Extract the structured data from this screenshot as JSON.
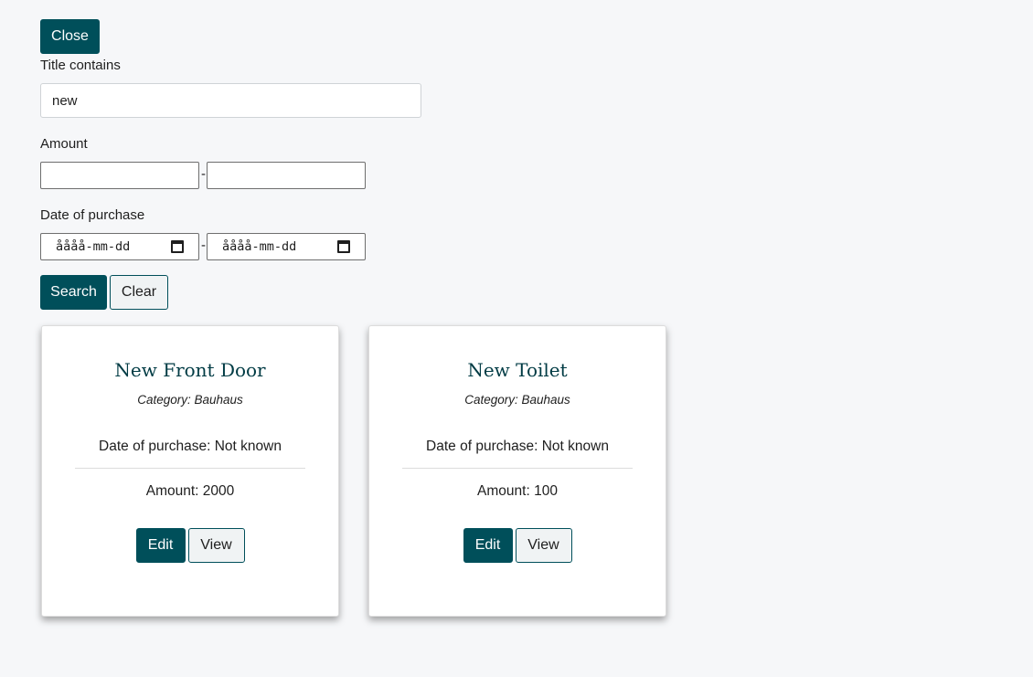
{
  "filter_panel": {
    "close_label": "Close",
    "title_label": "Title contains",
    "title_value": "new",
    "amount_label": "Amount",
    "amount_min": "",
    "amount_max": "",
    "range_separator": "-",
    "date_label": "Date of purchase",
    "date_from_placeholder": "åååå-mm-dd",
    "date_to_placeholder": "åååå-mm-dd",
    "search_label": "Search",
    "clear_label": "Clear"
  },
  "results": [
    {
      "title": "New Front Door",
      "category": "Category: Bauhaus",
      "date": "Date of purchase: Not known",
      "amount": "Amount: 2000",
      "edit_label": "Edit",
      "view_label": "View"
    },
    {
      "title": "New Toilet",
      "category": "Category: Bauhaus",
      "date": "Date of purchase: Not known",
      "amount": "Amount: 100",
      "edit_label": "Edit",
      "view_label": "View"
    }
  ],
  "colors": {
    "primary": "#004f5a",
    "background": "#f6f7f9",
    "card_title": "#003b44"
  }
}
